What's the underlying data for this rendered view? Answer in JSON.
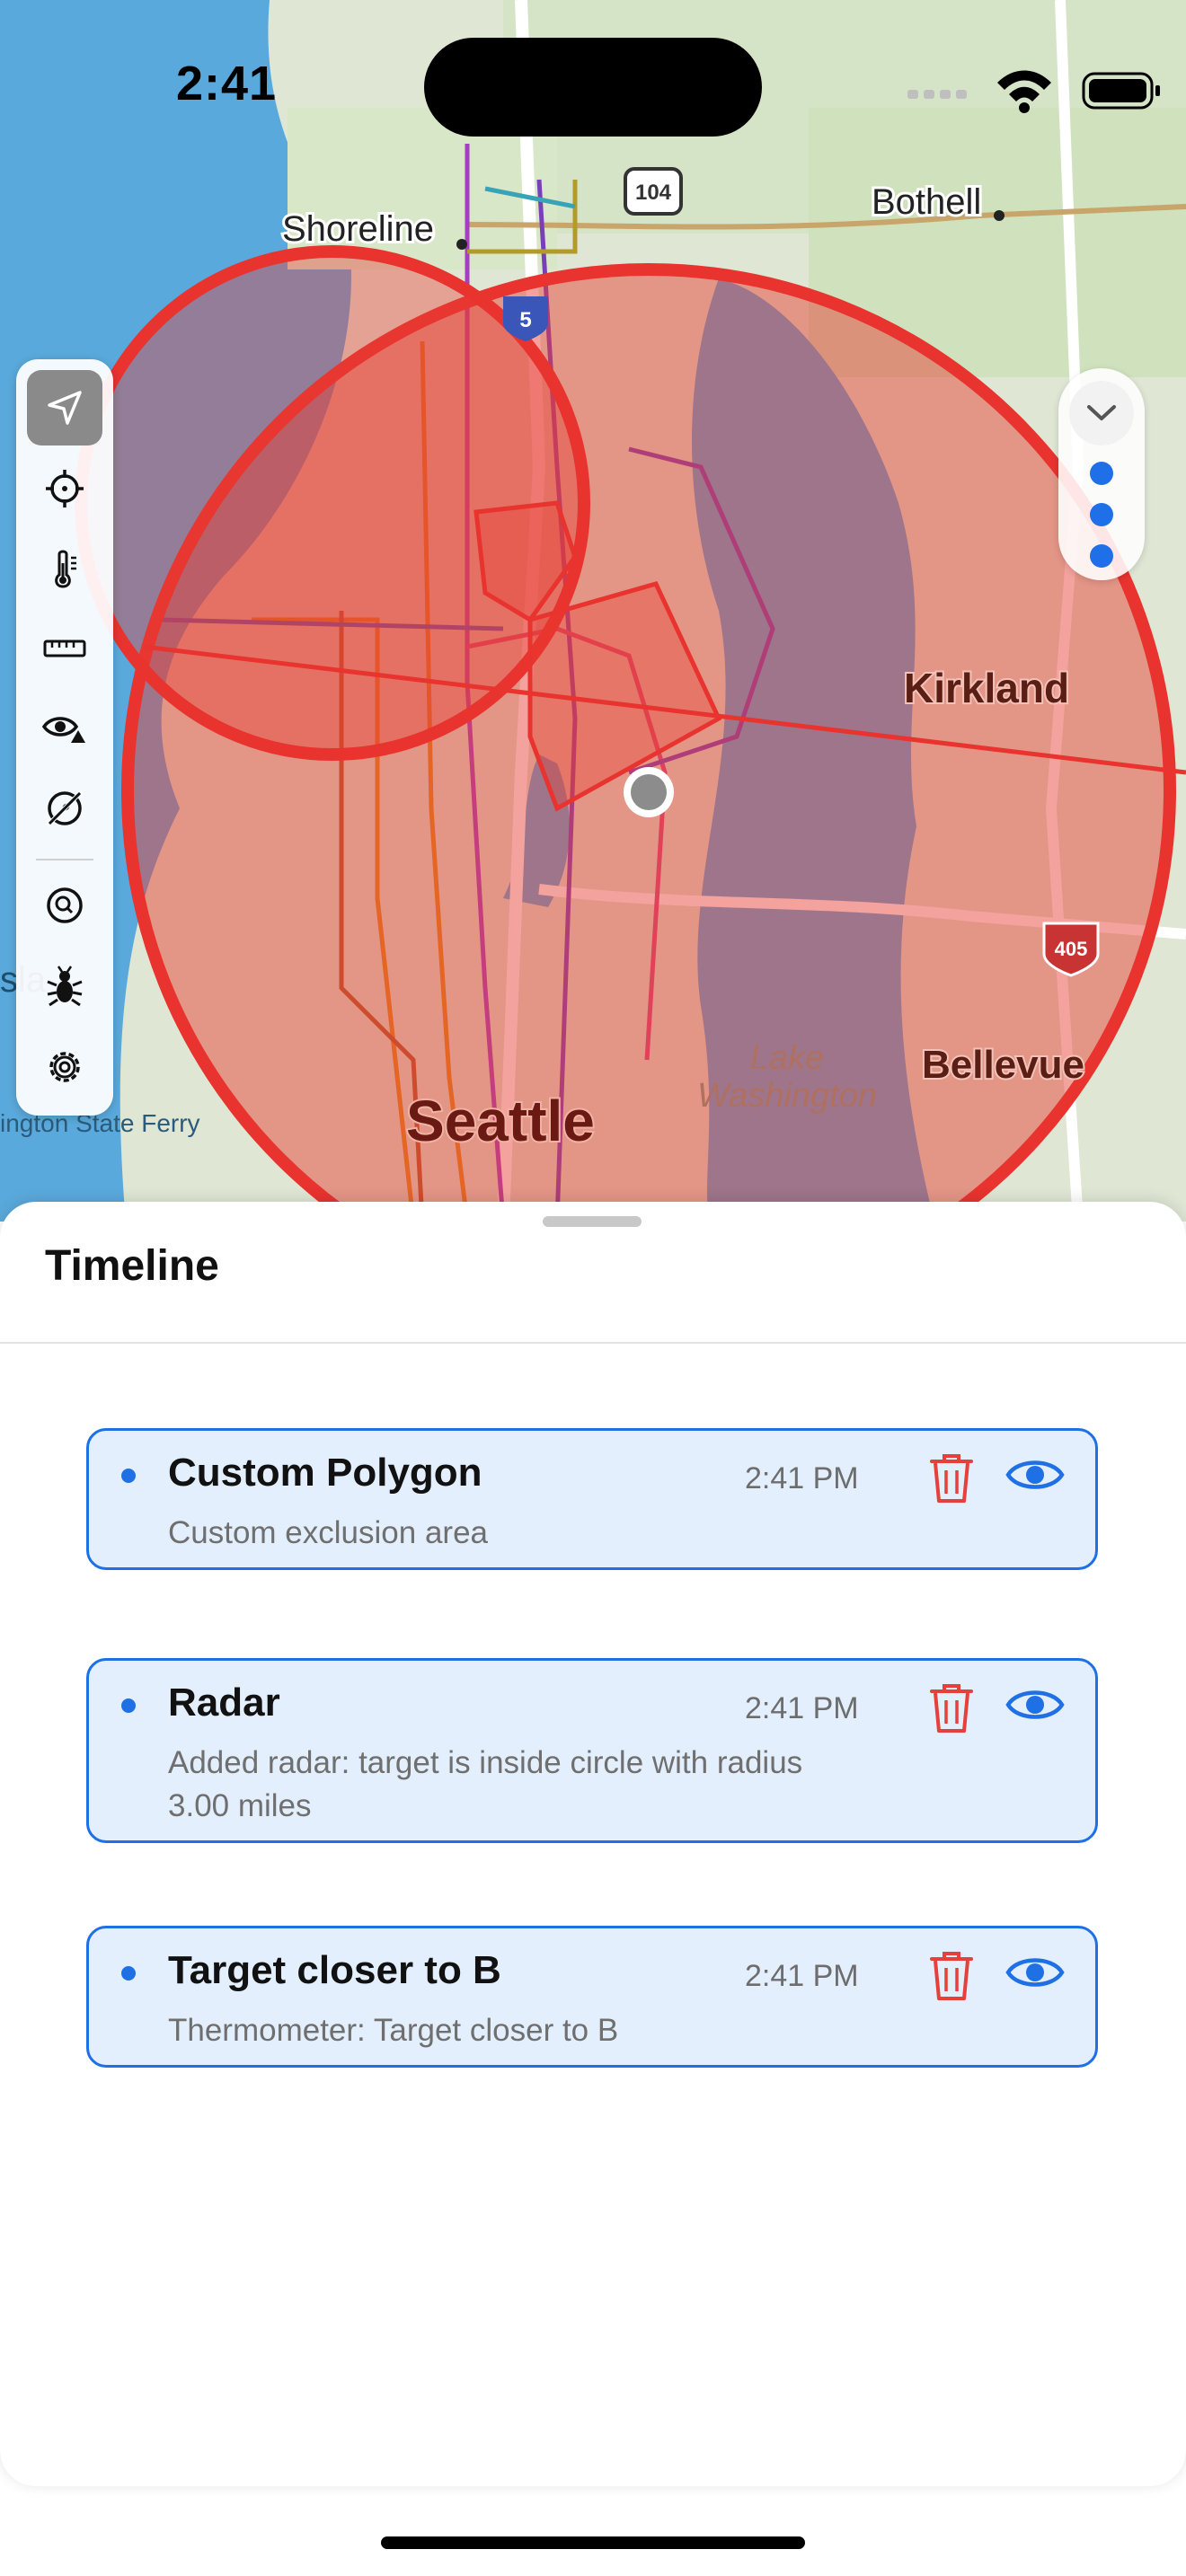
{
  "status_bar": {
    "time": "2:41"
  },
  "map": {
    "labels": {
      "shoreline": "Shoreline",
      "bothell": "Bothell",
      "kirkland": "Kirkland",
      "seattle": "Seattle",
      "bellevue": "Bellevue",
      "lake_washington_1": "Lake",
      "lake_washington_2": "Washington",
      "ferry": "ington State Ferry",
      "island_edge": "sla",
      "route_104": "104",
      "route_5": "5",
      "route_405": "405"
    },
    "overlay_color": "#e8332f"
  },
  "toolbar": {
    "tools": [
      {
        "icon": "location-arrow-icon",
        "active": true
      },
      {
        "icon": "crosshair-icon",
        "active": false
      },
      {
        "icon": "thermometer-icon",
        "active": false
      },
      {
        "icon": "ruler-icon",
        "active": false
      },
      {
        "icon": "eye-warning-icon",
        "active": false
      },
      {
        "icon": "compass-slash-icon",
        "active": false
      },
      {
        "icon": "magnifier-circle-icon",
        "active": false
      },
      {
        "icon": "ant-icon",
        "active": false
      },
      {
        "icon": "gear-icon",
        "active": false
      }
    ]
  },
  "pager": {
    "dots": 3
  },
  "sheet": {
    "title": "Timeline",
    "items": [
      {
        "title": "Custom Polygon",
        "time": "2:41 PM",
        "description": "Custom exclusion area"
      },
      {
        "title": "Radar",
        "time": "2:41 PM",
        "description": "Added radar: target is inside circle with radius 3.00 miles"
      },
      {
        "title": "Target closer to B",
        "time": "2:41 PM",
        "description": "Thermometer: Target closer to B"
      }
    ]
  },
  "colors": {
    "accent": "#1f6fe5",
    "danger": "#e5403a",
    "card_bg": "#e4effd"
  }
}
